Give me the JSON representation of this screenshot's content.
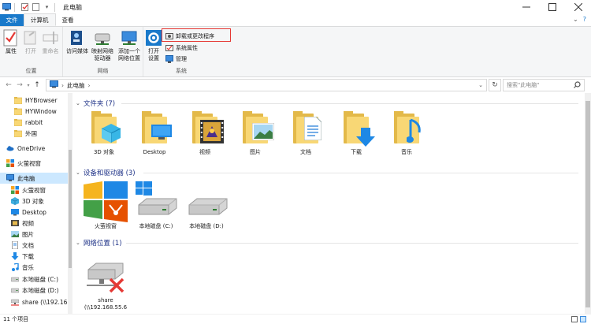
{
  "window": {
    "title": "此电脑",
    "controls": [
      "minimize",
      "maximize",
      "close"
    ]
  },
  "ribbon_tabs": [
    {
      "label": "文件"
    },
    {
      "label": "计算机"
    },
    {
      "label": "查看"
    }
  ],
  "ribbon": {
    "location_group": {
      "label": "位置",
      "buttons": [
        {
          "label": "属性",
          "icon": "check-properties-icon",
          "enabled": true
        },
        {
          "label": "打开",
          "icon": "open-icon",
          "enabled": false
        },
        {
          "label": "重命名",
          "icon": "rename-icon",
          "enabled": false
        }
      ]
    },
    "network_group": {
      "label": "网络",
      "buttons": [
        {
          "label": "访问媒体",
          "icon": "media-icon"
        },
        {
          "label": "映射网络\n驱动器",
          "icon": "map-drive-icon"
        },
        {
          "label": "添加一个\n网络位置",
          "icon": "add-network-location-icon"
        }
      ]
    },
    "system_group": {
      "label": "系统",
      "open_settings": {
        "label": "打开\n设置",
        "icon": "gear-icon"
      },
      "small_buttons": [
        {
          "label": "卸载或更改程序",
          "icon": "uninstall-icon"
        },
        {
          "label": "系统属性",
          "icon": "system-properties-icon"
        },
        {
          "label": "管理",
          "icon": "manage-icon"
        }
      ]
    }
  },
  "address": {
    "path": "此电脑",
    "search_placeholder": "搜索\"此电脑\""
  },
  "nav_pane": [
    {
      "label": "HYBrowser",
      "icon": "folder-icon"
    },
    {
      "label": "HYWindow",
      "icon": "folder-icon"
    },
    {
      "label": "rabbit",
      "icon": "folder-icon"
    },
    {
      "label": "外国",
      "icon": "folder-icon"
    },
    {
      "label": "OneDrive",
      "icon": "onedrive-icon"
    },
    {
      "label": "火萤视窗",
      "icon": "app-icon"
    },
    {
      "label": "此电脑",
      "icon": "computer-icon",
      "selected": true
    },
    {
      "label": "火萤视窗",
      "icon": "app-icon"
    },
    {
      "label": "3D 对象",
      "icon": "3d-objects-icon"
    },
    {
      "label": "Desktop",
      "icon": "desktop-icon"
    },
    {
      "label": "视频",
      "icon": "video-icon"
    },
    {
      "label": "图片",
      "icon": "pictures-icon"
    },
    {
      "label": "文档",
      "icon": "documents-icon"
    },
    {
      "label": "下载",
      "icon": "download-icon"
    },
    {
      "label": "音乐",
      "icon": "music-icon"
    },
    {
      "label": "本地磁盘 (C:)",
      "icon": "drive-icon"
    },
    {
      "label": "本地磁盘 (D:)",
      "icon": "drive-icon"
    },
    {
      "label": "share (\\\\192.16",
      "icon": "network-drive-icon"
    }
  ],
  "sections": {
    "folders": {
      "title": "文件夹 (7)",
      "items": [
        {
          "label": "3D 对象",
          "icon": "3d-objects-icon"
        },
        {
          "label": "Desktop",
          "icon": "desktop-icon"
        },
        {
          "label": "视频",
          "icon": "video-icon"
        },
        {
          "label": "图片",
          "icon": "pictures-icon"
        },
        {
          "label": "文档",
          "icon": "documents-icon"
        },
        {
          "label": "下载",
          "icon": "download-icon"
        },
        {
          "label": "音乐",
          "icon": "music-icon"
        }
      ]
    },
    "devices": {
      "title": "设备和驱动器 (3)",
      "items": [
        {
          "label": "火萤视窗",
          "icon": "app-icon"
        },
        {
          "label": "本地磁盘 (C:)",
          "icon": "windows-drive-icon"
        },
        {
          "label": "本地磁盘 (D:)",
          "icon": "drive-icon"
        }
      ]
    },
    "network": {
      "title": "网络位置 (1)",
      "items": [
        {
          "label": "share",
          "sublabel": "(\\\\192.168.55.6",
          "icon": "disconnected-network-drive-icon"
        }
      ]
    }
  },
  "status": {
    "item_count": "11 个项目"
  },
  "colors": {
    "accent": "#1979ca",
    "folder": "#f8d775",
    "section_title": "#1e3287",
    "highlight_box": "#e53935",
    "selection": "#cce8ff"
  }
}
